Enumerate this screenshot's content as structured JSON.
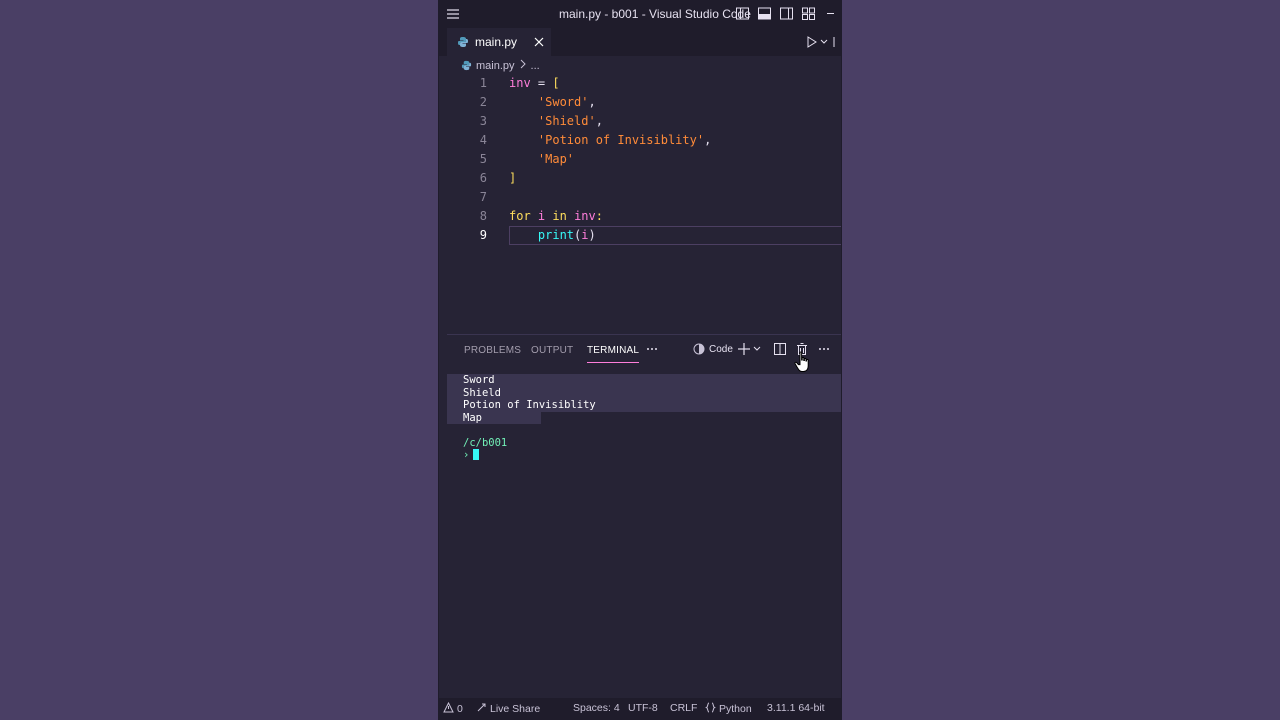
{
  "window": {
    "title": "main.py - b001 - Visual Studio Code"
  },
  "tabs": [
    {
      "label": "main.py",
      "active": true
    }
  ],
  "breadcrumb": {
    "file": "main.py",
    "more": "..."
  },
  "editor": {
    "lines": [
      {
        "n": "1",
        "tokens": [
          [
            "var",
            "inv"
          ],
          [
            "punc",
            " = "
          ],
          [
            "brk",
            "["
          ]
        ]
      },
      {
        "n": "2",
        "tokens": [
          [
            "punc",
            "    "
          ],
          [
            "str",
            "'Sword'"
          ],
          [
            "punc",
            ","
          ]
        ]
      },
      {
        "n": "3",
        "tokens": [
          [
            "punc",
            "    "
          ],
          [
            "str",
            "'Shield'"
          ],
          [
            "punc",
            ","
          ]
        ]
      },
      {
        "n": "4",
        "tokens": [
          [
            "punc",
            "    "
          ],
          [
            "str",
            "'Potion of Invisiblity'"
          ],
          [
            "punc",
            ","
          ]
        ]
      },
      {
        "n": "5",
        "tokens": [
          [
            "punc",
            "    "
          ],
          [
            "str",
            "'Map'"
          ]
        ]
      },
      {
        "n": "6",
        "tokens": [
          [
            "brk",
            "]"
          ]
        ]
      },
      {
        "n": "7",
        "tokens": []
      },
      {
        "n": "8",
        "tokens": [
          [
            "kw",
            "for"
          ],
          [
            "punc",
            " "
          ],
          [
            "var",
            "i"
          ],
          [
            "punc",
            " "
          ],
          [
            "kw",
            "in"
          ],
          [
            "punc",
            " "
          ],
          [
            "var",
            "inv"
          ],
          [
            "kw",
            ":"
          ]
        ]
      },
      {
        "n": "9",
        "tokens": [
          [
            "punc",
            "    "
          ],
          [
            "fn",
            "print"
          ],
          [
            "punc",
            "("
          ],
          [
            "var",
            "i"
          ],
          [
            "punc",
            ")"
          ]
        ]
      }
    ],
    "active_line": "9"
  },
  "panel": {
    "tabs": [
      "PROBLEMS",
      "OUTPUT",
      "TERMINAL"
    ],
    "active_tab": "TERMINAL",
    "terminal_profile": "Code"
  },
  "terminal": {
    "output": [
      "Sword",
      "Shield",
      "Potion of Invisiblity",
      "Map"
    ],
    "path": "/c/b001",
    "prompt": "›"
  },
  "statusbar": {
    "problems": "0",
    "live_share": "Live Share",
    "spaces": "Spaces: 4",
    "encoding": "UTF-8",
    "eol": "CRLF",
    "language": "Python",
    "interpreter": "3.11.1 64-bit"
  },
  "colors": {
    "background": "#4a3f65",
    "editor_bg": "#262335",
    "chrome_bg": "#1f1c2b",
    "keyword": "#fede5d",
    "variable": "#ff7edb",
    "string": "#ff8b39",
    "function": "#36f9f6",
    "terminal_path": "#72f1b8"
  }
}
